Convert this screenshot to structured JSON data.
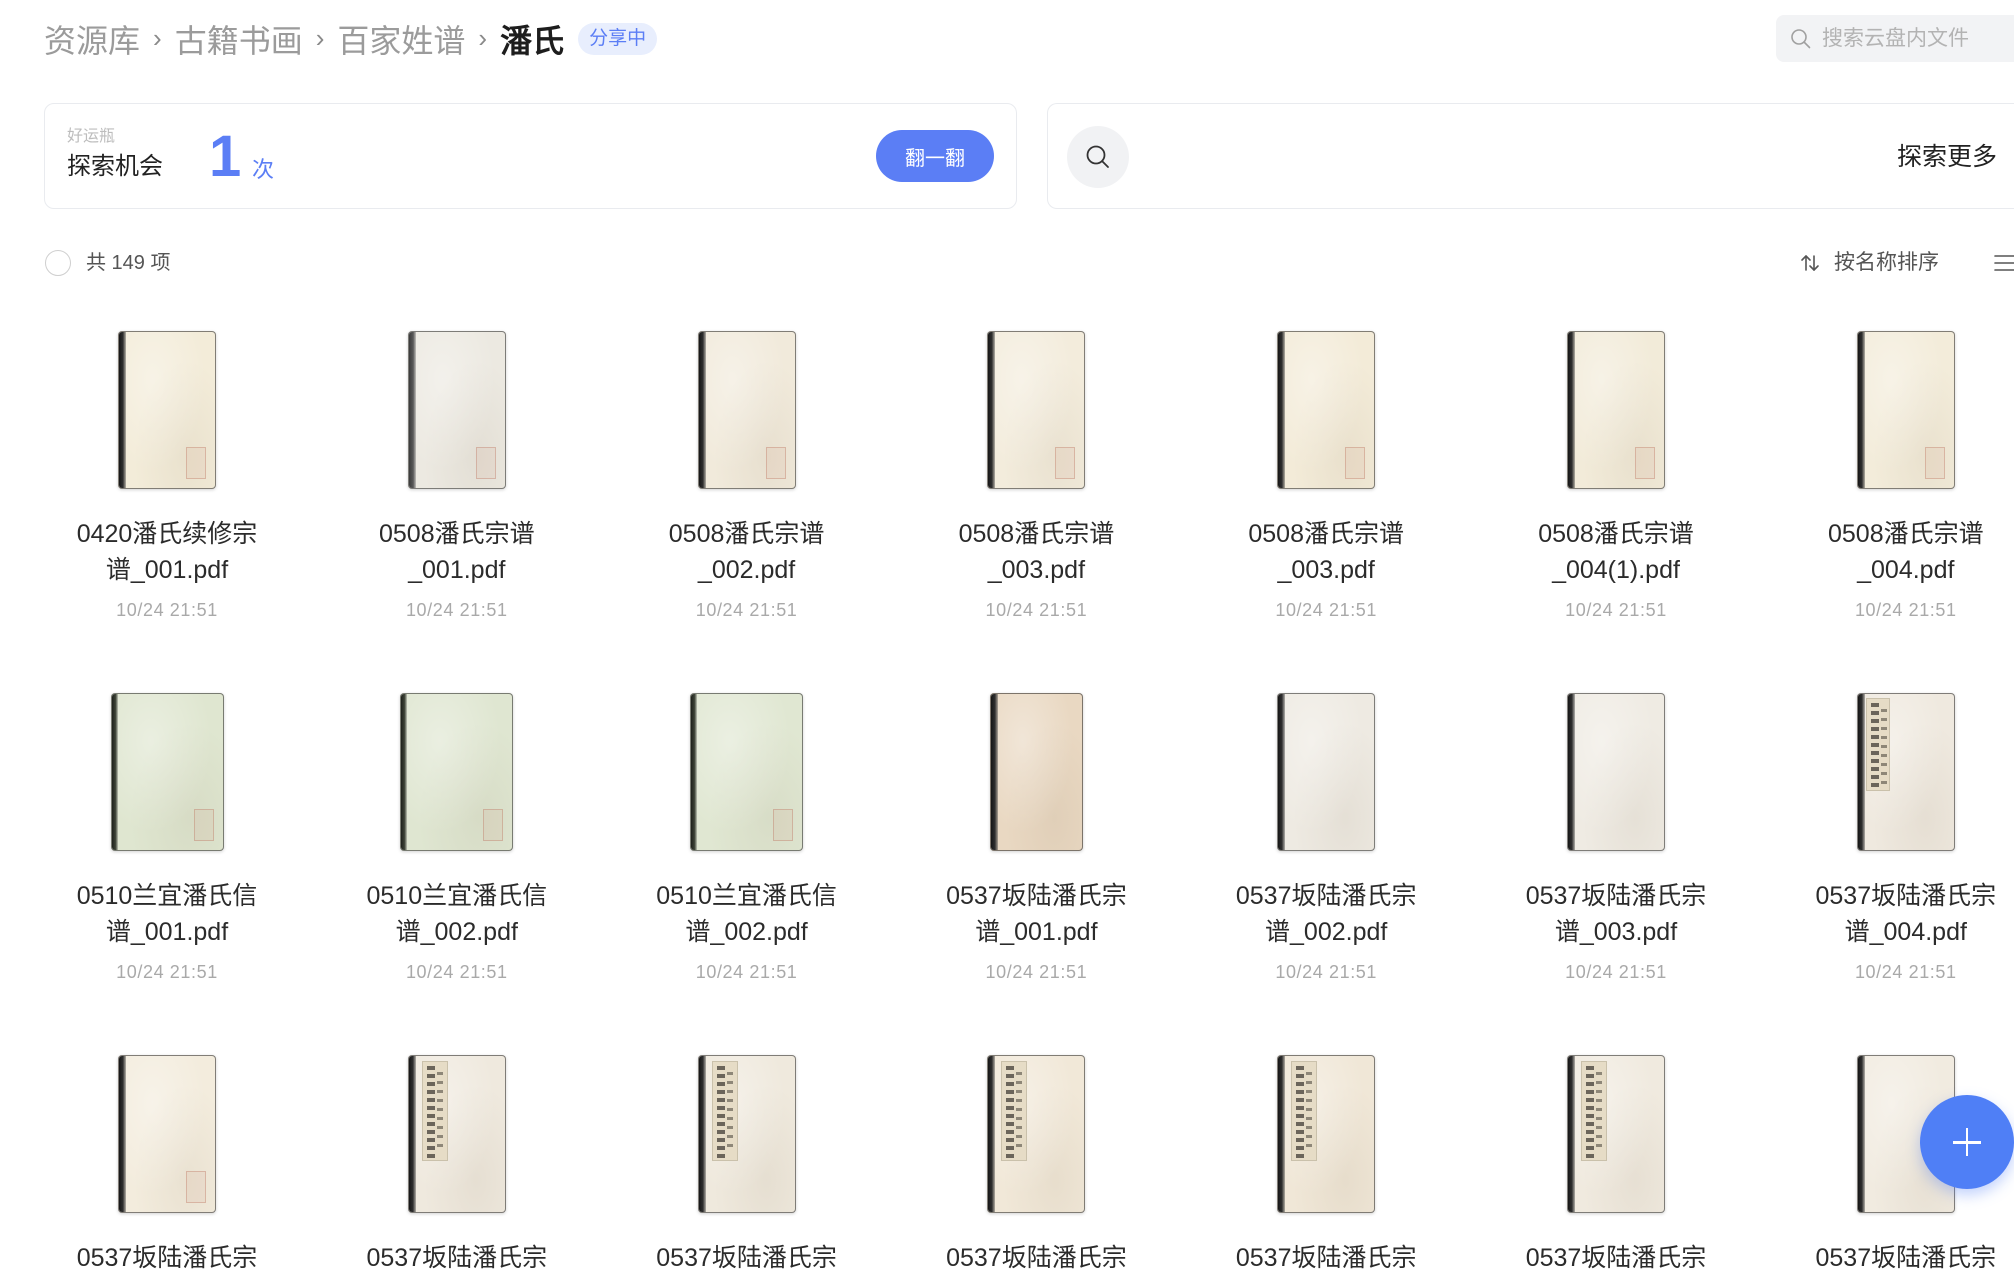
{
  "theme": {
    "accent": "#5b7ef5",
    "fab_color": "#4f7ff6"
  },
  "breadcrumb": {
    "items": [
      "资源库",
      "古籍书画",
      "百家姓谱"
    ],
    "separator": "›",
    "current": "潘氏",
    "badge": "分享中"
  },
  "search": {
    "icon": "search-icon",
    "placeholder": "搜索云盘内文件"
  },
  "lucky_card": {
    "label": "好运瓶",
    "title": "探索机会",
    "count": "1",
    "unit": "次",
    "button": "翻一翻"
  },
  "explore_card": {
    "icon": "search-icon",
    "label": "探索更多"
  },
  "toolbar": {
    "total": "共 149 项",
    "sort_icon": "sort-icon",
    "sort_label": "按名称排序",
    "view_icon": "list-view-icon"
  },
  "files": [
    {
      "name_lines": [
        "0420潘氏续修宗",
        "谱_001.pdf"
      ],
      "date": "10/24 21:51",
      "cover": {
        "tone": "cream",
        "color": "#f3ecd9",
        "detail": "seal"
      }
    },
    {
      "name_lines": [
        "0508潘氏宗谱",
        "_001.pdf"
      ],
      "date": "10/24 21:51",
      "cover": {
        "tone": "grey",
        "color": "#ece9e1",
        "detail": "seal"
      }
    },
    {
      "name_lines": [
        "0508潘氏宗谱",
        "_002.pdf"
      ],
      "date": "10/24 21:51",
      "cover": {
        "tone": "cream",
        "color": "#f1eadb",
        "detail": "seal"
      }
    },
    {
      "name_lines": [
        "0508潘氏宗谱",
        "_003.pdf"
      ],
      "date": "10/24 21:51",
      "cover": {
        "tone": "cream",
        "color": "#f3ecdc",
        "detail": "seal"
      }
    },
    {
      "name_lines": [
        "0508潘氏宗谱",
        "_003.pdf"
      ],
      "date": "10/24 21:51",
      "cover": {
        "tone": "cream",
        "color": "#f3ebd8",
        "detail": "seal"
      }
    },
    {
      "name_lines": [
        "0508潘氏宗谱",
        "_004(1).pdf"
      ],
      "date": "10/24 21:51",
      "cover": {
        "tone": "cream",
        "color": "#f2ebd9",
        "detail": "seal"
      }
    },
    {
      "name_lines": [
        "0508潘氏宗谱",
        "_004.pdf"
      ],
      "date": "10/24 21:51",
      "cover": {
        "tone": "cream",
        "color": "#f3ecda",
        "detail": "seal"
      }
    },
    {
      "name_lines": [
        "0510兰宜潘氏信",
        "谱_001.pdf"
      ],
      "date": "10/24 21:51",
      "cover": {
        "tone": "green",
        "color": "#dfe6d0",
        "detail": "seal"
      }
    },
    {
      "name_lines": [
        "0510兰宜潘氏信",
        "谱_002.pdf"
      ],
      "date": "10/24 21:51",
      "cover": {
        "tone": "green",
        "color": "#dfe6d1",
        "detail": "seal"
      }
    },
    {
      "name_lines": [
        "0510兰宜潘氏信",
        "谱_002.pdf"
      ],
      "date": "10/24 21:51",
      "cover": {
        "tone": "green",
        "color": "#e0e7d2",
        "detail": "seal"
      }
    },
    {
      "name_lines": [
        "0537坂陆潘氏宗",
        "谱_001.pdf"
      ],
      "date": "10/24 21:51",
      "cover": {
        "tone": "tan",
        "color": "#e9d8c2",
        "detail": "plain"
      }
    },
    {
      "name_lines": [
        "0537坂陆潘氏宗",
        "谱_002.pdf"
      ],
      "date": "10/24 21:51",
      "cover": {
        "tone": "white",
        "color": "#eeeae2",
        "detail": "plain"
      }
    },
    {
      "name_lines": [
        "0537坂陆潘氏宗",
        "谱_003.pdf"
      ],
      "date": "10/24 21:51",
      "cover": {
        "tone": "white",
        "color": "#efebe3",
        "detail": "plain"
      }
    },
    {
      "name_lines": [
        "0537坂陆潘氏宗",
        "谱_004.pdf"
      ],
      "date": "10/24 21:51",
      "cover": {
        "tone": "white",
        "color": "#efe9df",
        "detail": "label"
      }
    },
    {
      "name_lines": [
        "0537坂陆潘氏宗"
      ],
      "cover": {
        "tone": "cream",
        "color": "#f3ecdd",
        "detail": "seal"
      }
    },
    {
      "name_lines": [
        "0537坂陆潘氏宗"
      ],
      "cover": {
        "tone": "white",
        "color": "#efe9de",
        "detail": "strip"
      }
    },
    {
      "name_lines": [
        "0537坂陆潘氏宗"
      ],
      "cover": {
        "tone": "white",
        "color": "#efe9dd",
        "detail": "strip"
      }
    },
    {
      "name_lines": [
        "0537坂陆潘氏宗"
      ],
      "cover": {
        "tone": "cream",
        "color": "#f1e8d8",
        "detail": "strip"
      }
    },
    {
      "name_lines": [
        "0537坂陆潘氏宗"
      ],
      "cover": {
        "tone": "cream",
        "color": "#f0e7d7",
        "detail": "strip"
      }
    },
    {
      "name_lines": [
        "0537坂陆潘氏宗"
      ],
      "cover": {
        "tone": "white",
        "color": "#f0eadf",
        "detail": "strip"
      }
    },
    {
      "name_lines": [
        "0537坂陆潘氏宗"
      ],
      "cover": {
        "tone": "white",
        "color": "#f1ebe0",
        "detail": "plain"
      }
    }
  ],
  "fab": {
    "icon": "plus-icon"
  }
}
